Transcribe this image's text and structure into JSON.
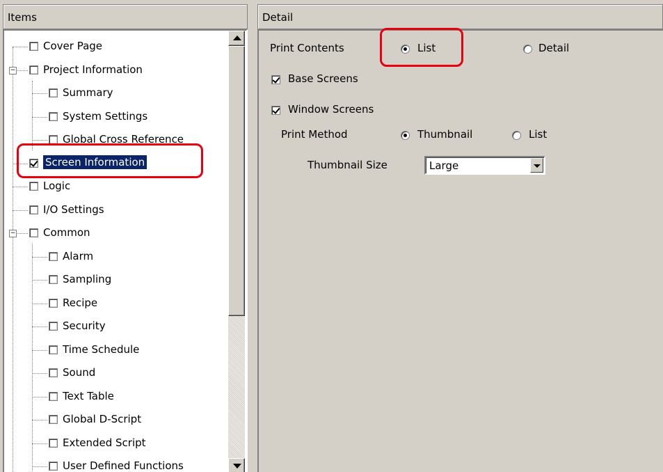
{
  "items_panel": {
    "header": "Items",
    "tree": [
      {
        "label": "Cover Page",
        "level": 0,
        "checked": false,
        "expander": null,
        "selected": false
      },
      {
        "label": "Project Information",
        "level": 0,
        "checked": false,
        "expander": "−",
        "selected": false
      },
      {
        "label": "Summary",
        "level": 1,
        "checked": false,
        "expander": null,
        "selected": false
      },
      {
        "label": "System Settings",
        "level": 1,
        "checked": false,
        "expander": null,
        "selected": false
      },
      {
        "label": "Global Cross Reference",
        "level": 1,
        "checked": false,
        "expander": null,
        "selected": false
      },
      {
        "label": "Screen Information",
        "level": 0,
        "checked": true,
        "expander": null,
        "selected": true
      },
      {
        "label": "Logic",
        "level": 0,
        "checked": false,
        "expander": null,
        "selected": false
      },
      {
        "label": "I/O Settings",
        "level": 0,
        "checked": false,
        "expander": null,
        "selected": false
      },
      {
        "label": "Common",
        "level": 0,
        "checked": false,
        "expander": "−",
        "selected": false
      },
      {
        "label": "Alarm",
        "level": 1,
        "checked": false,
        "expander": null,
        "selected": false
      },
      {
        "label": "Sampling",
        "level": 1,
        "checked": false,
        "expander": null,
        "selected": false
      },
      {
        "label": "Recipe",
        "level": 1,
        "checked": false,
        "expander": null,
        "selected": false
      },
      {
        "label": "Security",
        "level": 1,
        "checked": false,
        "expander": null,
        "selected": false
      },
      {
        "label": "Time Schedule",
        "level": 1,
        "checked": false,
        "expander": null,
        "selected": false
      },
      {
        "label": "Sound",
        "level": 1,
        "checked": false,
        "expander": null,
        "selected": false
      },
      {
        "label": "Text Table",
        "level": 1,
        "checked": false,
        "expander": null,
        "selected": false
      },
      {
        "label": "Global D-Script",
        "level": 1,
        "checked": false,
        "expander": null,
        "selected": false
      },
      {
        "label": "Extended Script",
        "level": 1,
        "checked": false,
        "expander": null,
        "selected": false
      },
      {
        "label": "User Defined Functions",
        "level": 1,
        "checked": false,
        "expander": null,
        "selected": false
      }
    ]
  },
  "detail_panel": {
    "header": "Detail",
    "print_contents": {
      "label": "Print Contents",
      "options": [
        "List",
        "Detail"
      ],
      "selected": "List"
    },
    "base_screens": {
      "label": "Base Screens",
      "checked": true
    },
    "window_screens": {
      "label": "Window Screens",
      "checked": true
    },
    "print_method": {
      "label": "Print Method",
      "options": [
        "Thumbnail",
        "List"
      ],
      "selected": "Thumbnail"
    },
    "thumbnail_size": {
      "label": "Thumbnail Size",
      "value": "Large"
    }
  },
  "colors": {
    "highlight": "#e8000f",
    "selection": "#0a246a",
    "face": "#d4d0c8"
  }
}
